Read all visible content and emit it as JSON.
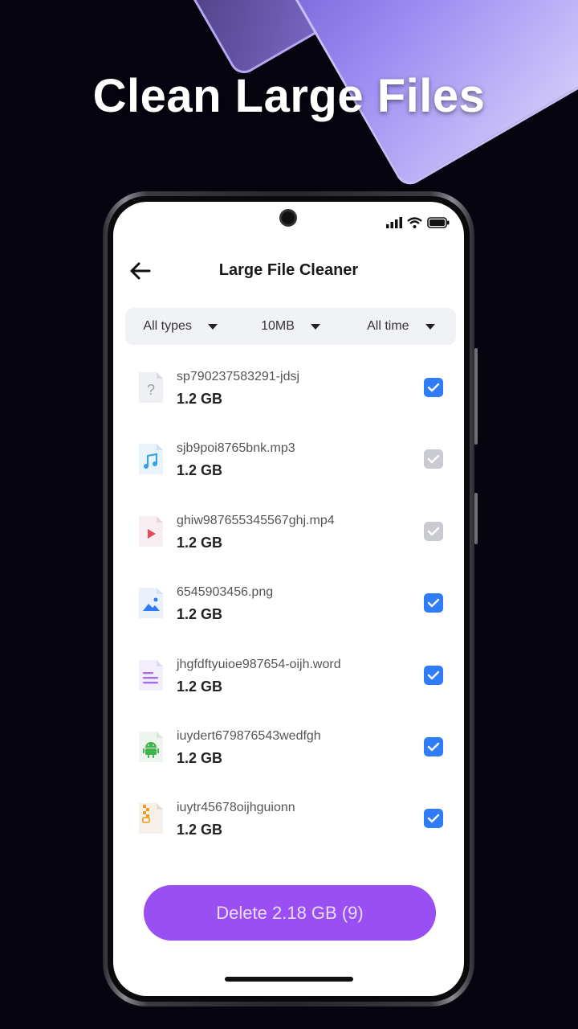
{
  "headline": "Clean Large Files",
  "screen": {
    "title": "Large File Cleaner",
    "filters": [
      {
        "label": "All types"
      },
      {
        "label": "10MB"
      },
      {
        "label": "All time"
      }
    ],
    "files": [
      {
        "name": "sp790237583291-jdsj",
        "size": "1.2 GB",
        "icon": "unknown-file-icon",
        "checked": true
      },
      {
        "name": "sjb9poi8765bnk.mp3",
        "size": "1.2 GB",
        "icon": "audio-file-icon",
        "checked": false
      },
      {
        "name": "ghiw987655345567ghj.mp4",
        "size": "1.2 GB",
        "icon": "video-file-icon",
        "checked": false
      },
      {
        "name": "6545903456.png",
        "size": "1.2 GB",
        "icon": "image-file-icon",
        "checked": true
      },
      {
        "name": "jhgfdftyuioe987654-oijh.word",
        "size": "1.2 GB",
        "icon": "document-file-icon",
        "checked": true
      },
      {
        "name": "iuydert679876543wedfgh",
        "size": "1.2 GB",
        "icon": "apk-file-icon",
        "checked": true
      },
      {
        "name": "iuytr45678oijhguionn",
        "size": "1.2 GB",
        "icon": "archive-file-icon",
        "checked": true
      }
    ],
    "delete_label": "Delete 2.18 GB (9)"
  },
  "colors": {
    "accent": "#9a4ff2",
    "checkbox_on": "#2f7cf6",
    "checkbox_off": "#c9cbd1",
    "background": "#05040f"
  }
}
